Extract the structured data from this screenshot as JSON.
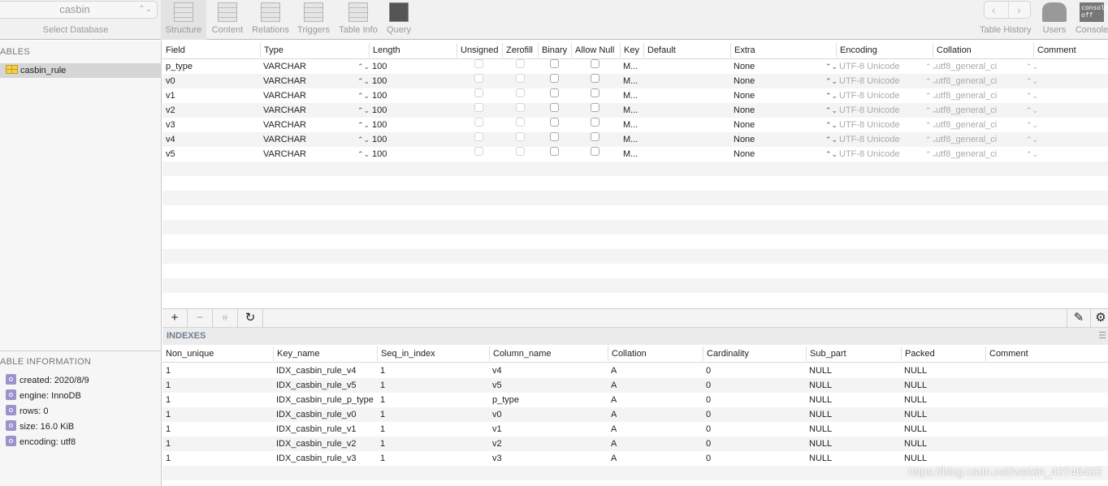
{
  "toolbar": {
    "database": "casbin",
    "select_database_label": "Select Database",
    "tabs": [
      {
        "label": "Structure",
        "icon": "structure-icon",
        "active": true
      },
      {
        "label": "Content",
        "icon": "content-icon"
      },
      {
        "label": "Relations",
        "icon": "relations-icon"
      },
      {
        "label": "Triggers",
        "icon": "triggers-icon"
      },
      {
        "label": "Table Info",
        "icon": "table-info-icon"
      },
      {
        "label": "Query",
        "icon": "query-icon"
      }
    ],
    "table_history_label": "Table History",
    "users_label": "Users",
    "console_label": "Console",
    "console_icon_text": "console off"
  },
  "sidebar": {
    "tables_heading": "ABLES",
    "tables": [
      "casbin_rule"
    ],
    "info_heading": "ABLE INFORMATION",
    "info": [
      "created: 2020/8/9",
      "engine: InnoDB",
      "rows: 0",
      "size: 16.0 KiB",
      "encoding: utf8"
    ]
  },
  "structure": {
    "columns": [
      "Field",
      "Type",
      "Length",
      "Unsigned",
      "Zerofill",
      "Binary",
      "Allow Null",
      "Key",
      "Default",
      "Extra",
      "Encoding",
      "Collation",
      "Comment"
    ],
    "rows": [
      {
        "field": "p_type",
        "type": "VARCHAR",
        "length": "100",
        "key": "M...",
        "default": "",
        "extra": "None",
        "encoding": "UTF-8 Unicode",
        "collation": "utf8_general_ci",
        "comment": ""
      },
      {
        "field": "v0",
        "type": "VARCHAR",
        "length": "100",
        "key": "M...",
        "default": "",
        "extra": "None",
        "encoding": "UTF-8 Unicode",
        "collation": "utf8_general_ci",
        "comment": ""
      },
      {
        "field": "v1",
        "type": "VARCHAR",
        "length": "100",
        "key": "M...",
        "default": "",
        "extra": "None",
        "encoding": "UTF-8 Unicode",
        "collation": "utf8_general_ci",
        "comment": ""
      },
      {
        "field": "v2",
        "type": "VARCHAR",
        "length": "100",
        "key": "M...",
        "default": "",
        "extra": "None",
        "encoding": "UTF-8 Unicode",
        "collation": "utf8_general_ci",
        "comment": ""
      },
      {
        "field": "v3",
        "type": "VARCHAR",
        "length": "100",
        "key": "M...",
        "default": "",
        "extra": "None",
        "encoding": "UTF-8 Unicode",
        "collation": "utf8_general_ci",
        "comment": ""
      },
      {
        "field": "v4",
        "type": "VARCHAR",
        "length": "100",
        "key": "M...",
        "default": "",
        "extra": "None",
        "encoding": "UTF-8 Unicode",
        "collation": "utf8_general_ci",
        "comment": ""
      },
      {
        "field": "v5",
        "type": "VARCHAR",
        "length": "100",
        "key": "M...",
        "default": "",
        "extra": "None",
        "encoding": "UTF-8 Unicode",
        "collation": "utf8_general_ci",
        "comment": ""
      }
    ],
    "buttons": {
      "add": "+",
      "remove": "−",
      "duplicate": "⧺",
      "refresh": "↻",
      "edit": "✎",
      "settings": "⚙"
    }
  },
  "indexes": {
    "heading": "INDEXES",
    "columns": [
      "Non_unique",
      "Key_name",
      "Seq_in_index",
      "Column_name",
      "Collation",
      "Cardinality",
      "Sub_part",
      "Packed",
      "Comment"
    ],
    "rows": [
      [
        "1",
        "IDX_casbin_rule_v4",
        "1",
        "v4",
        "A",
        "0",
        "NULL",
        "NULL",
        ""
      ],
      [
        "1",
        "IDX_casbin_rule_v5",
        "1",
        "v5",
        "A",
        "0",
        "NULL",
        "NULL",
        ""
      ],
      [
        "1",
        "IDX_casbin_rule_p_type",
        "1",
        "p_type",
        "A",
        "0",
        "NULL",
        "NULL",
        ""
      ],
      [
        "1",
        "IDX_casbin_rule_v0",
        "1",
        "v0",
        "A",
        "0",
        "NULL",
        "NULL",
        ""
      ],
      [
        "1",
        "IDX_casbin_rule_v1",
        "1",
        "v1",
        "A",
        "0",
        "NULL",
        "NULL",
        ""
      ],
      [
        "1",
        "IDX_casbin_rule_v2",
        "1",
        "v2",
        "A",
        "0",
        "NULL",
        "NULL",
        ""
      ],
      [
        "1",
        "IDX_casbin_rule_v3",
        "1",
        "v3",
        "A",
        "0",
        "NULL",
        "NULL",
        ""
      ]
    ]
  },
  "watermark": "https://blog.csdn.net/weixin_43746433"
}
